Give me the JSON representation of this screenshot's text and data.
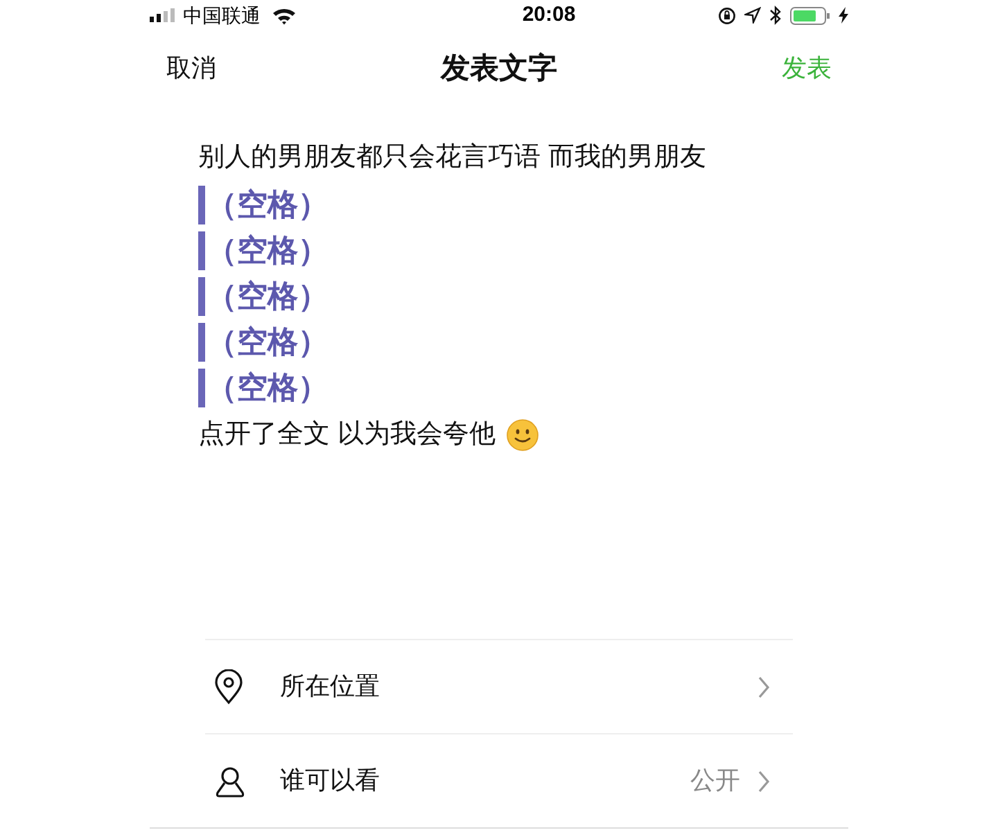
{
  "status_bar": {
    "carrier": "中国联通",
    "time": "20:08"
  },
  "nav": {
    "cancel": "取消",
    "title": "发表文字",
    "publish": "发表"
  },
  "post_lines": [
    {
      "kind": "text",
      "text": "别人的男朋友都只会花言巧语 而我的男朋友"
    },
    {
      "kind": "space",
      "text": "（空格）"
    },
    {
      "kind": "space",
      "text": "（空格）"
    },
    {
      "kind": "space",
      "text": "（空格）"
    },
    {
      "kind": "space",
      "text": "（空格）"
    },
    {
      "kind": "space",
      "text": "（空格）"
    },
    {
      "kind": "emoji",
      "text": "点开了全文 以为我会夸他"
    }
  ],
  "options": [
    {
      "kind": "location",
      "label": "所在位置"
    },
    {
      "kind": "visibility",
      "label": "谁可以看",
      "value": "公开"
    }
  ]
}
